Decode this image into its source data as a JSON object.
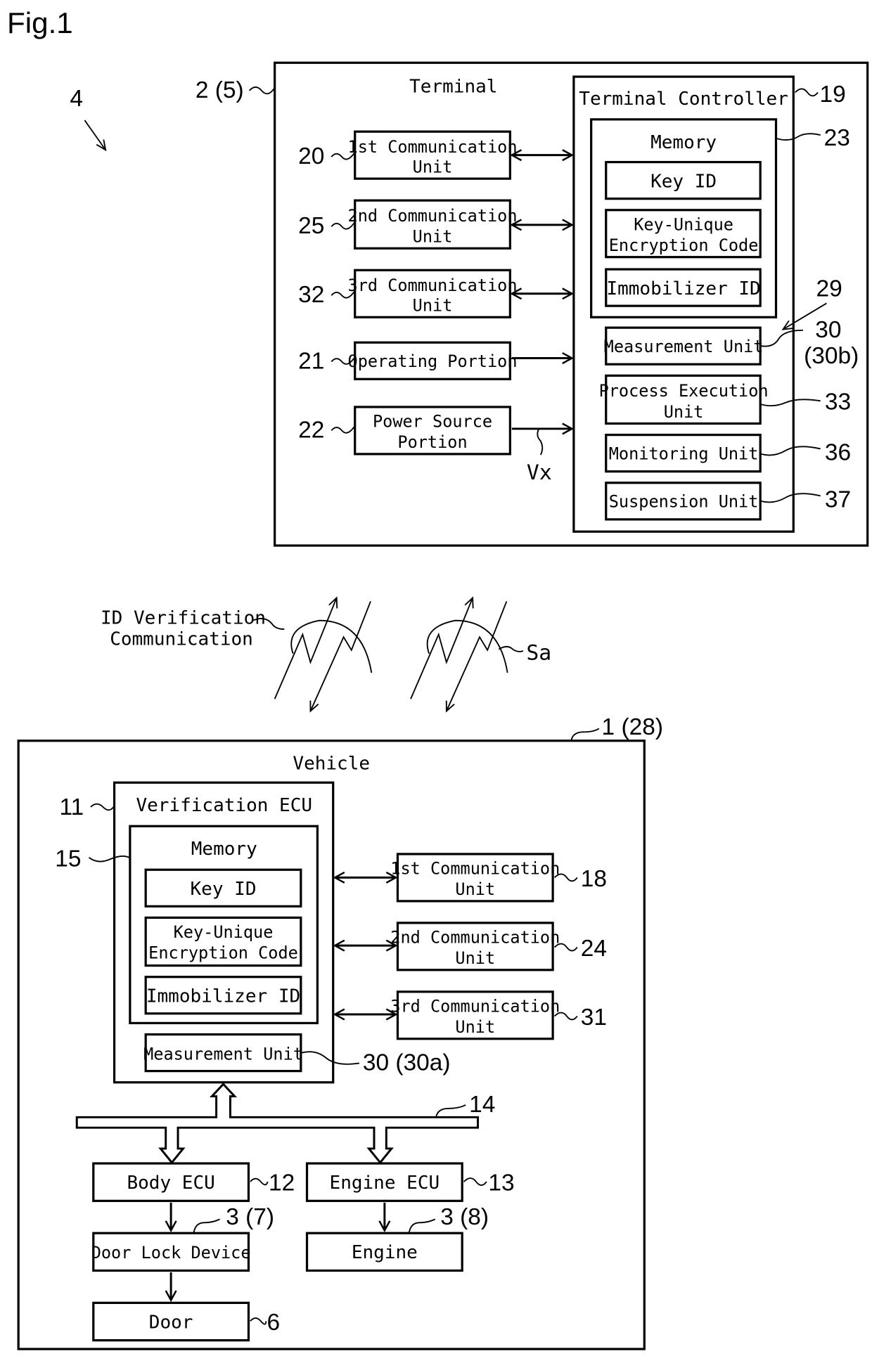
{
  "figure_title": "Fig.1",
  "system_ref": "4",
  "terminal": {
    "title": "Terminal",
    "ref": "2 (5)",
    "units": [
      {
        "line1": "1st Communication",
        "line2": "Unit",
        "ref": "20"
      },
      {
        "line1": "2nd Communication",
        "line2": "Unit",
        "ref": "25"
      },
      {
        "line1": "3rd Communication",
        "line2": "Unit",
        "ref": "32"
      },
      {
        "line1": "Operating Portion",
        "line2": "",
        "ref": "21"
      },
      {
        "line1": "Power Source",
        "line2": "Portion",
        "ref": "22"
      }
    ],
    "voltage_label": "Vx",
    "controller": {
      "title": "Terminal Controller",
      "ref": "19",
      "memory": {
        "title": "Memory",
        "ref": "23",
        "items": [
          {
            "line1": "Key ID",
            "line2": ""
          },
          {
            "line1": "Key-Unique",
            "line2": "Encryption Code"
          },
          {
            "line1": "Immobilizer ID",
            "line2": ""
          }
        ]
      },
      "group_ref": "29",
      "units": [
        {
          "line1": "Measurement Unit",
          "line2": "",
          "ref": "30",
          "ref2": "(30b)"
        },
        {
          "line1": "Process Execution",
          "line2": "Unit",
          "ref": "33"
        },
        {
          "line1": "Monitoring Unit",
          "line2": "",
          "ref": "36"
        },
        {
          "line1": "Suspension Unit",
          "line2": "",
          "ref": "37"
        }
      ]
    }
  },
  "wireless": {
    "label_line1": "ID Verification",
    "label_line2": "Communication",
    "signal_ref": "Sa"
  },
  "vehicle": {
    "title": "Vehicle",
    "ref": "1 (28)",
    "ecu": {
      "title": "Verification ECU",
      "ref": "11",
      "memory": {
        "title": "Memory",
        "ref": "15",
        "items": [
          {
            "line1": "Key ID",
            "line2": ""
          },
          {
            "line1": "Key-Unique",
            "line2": "Encryption Code"
          },
          {
            "line1": "Immobilizer ID",
            "line2": ""
          }
        ]
      },
      "measurement": {
        "label": "Measurement Unit",
        "ref": "30 (30a)"
      }
    },
    "comm_units": [
      {
        "line1": "1st Communication",
        "line2": "Unit",
        "ref": "18"
      },
      {
        "line1": "2nd Communication",
        "line2": "Unit",
        "ref": "24"
      },
      {
        "line1": "3rd Communication",
        "line2": "Unit",
        "ref": "31"
      }
    ],
    "bus_ref": "14",
    "body_ecu": {
      "label": "Body ECU",
      "ref": "12"
    },
    "engine_ecu": {
      "label": "Engine ECU",
      "ref": "13"
    },
    "door_lock": {
      "label": "Door Lock Device",
      "ref": "3 (7)"
    },
    "engine": {
      "label": "Engine",
      "ref": "3 (8)"
    },
    "door": {
      "label": "Door",
      "ref": "6"
    }
  }
}
